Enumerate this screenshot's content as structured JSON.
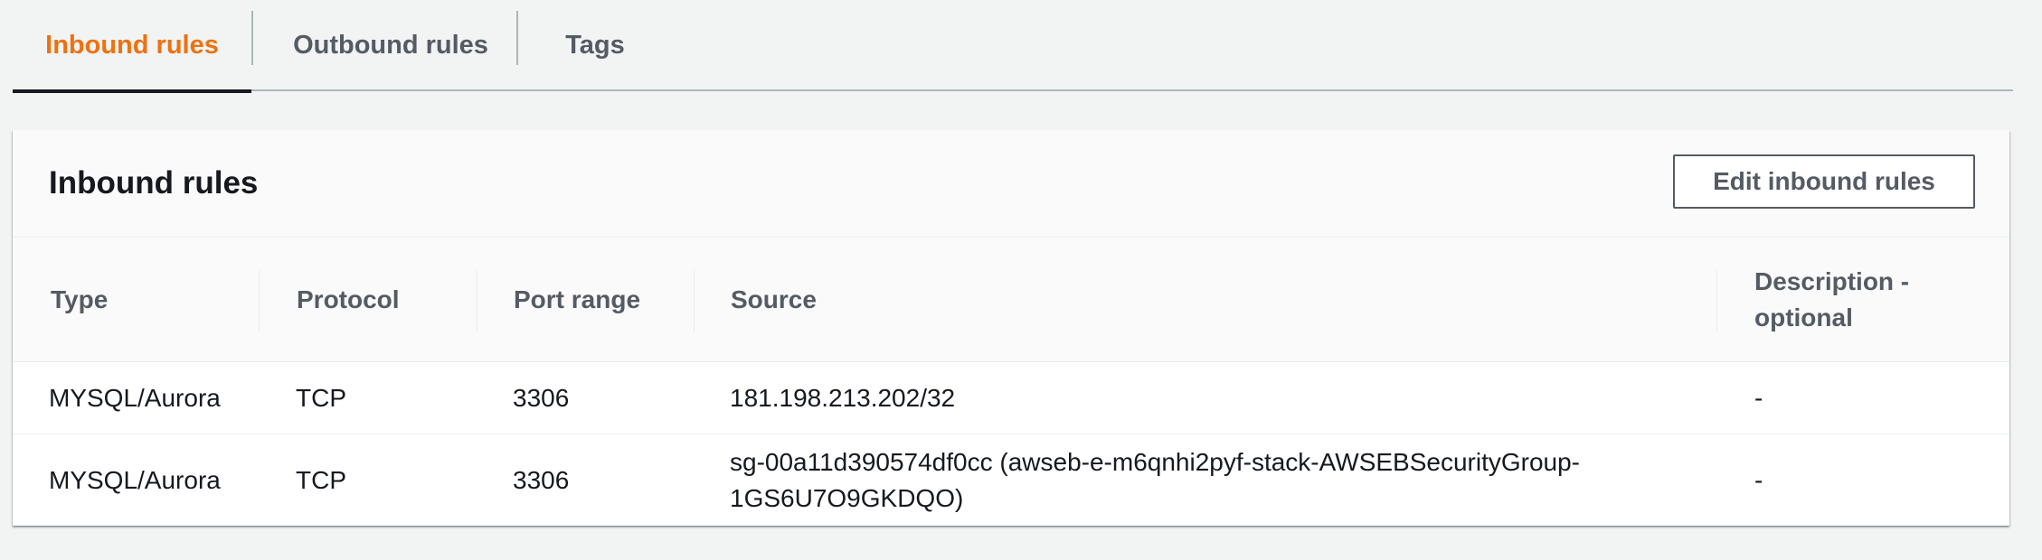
{
  "tabs": [
    {
      "label": "Inbound rules",
      "active": true
    },
    {
      "label": "Outbound rules",
      "active": false
    },
    {
      "label": "Tags",
      "active": false
    }
  ],
  "panel": {
    "title": "Inbound rules",
    "edit_button_label": "Edit inbound rules"
  },
  "table": {
    "columns": {
      "type": "Type",
      "protocol": "Protocol",
      "port_range": "Port range",
      "source": "Source",
      "description": "Description - optional"
    },
    "rows": [
      {
        "type": "MYSQL/Aurora",
        "protocol": "TCP",
        "port_range": "3306",
        "source": "181.198.213.202/32",
        "description": "-"
      },
      {
        "type": "MYSQL/Aurora",
        "protocol": "TCP",
        "port_range": "3306",
        "source": "sg-00a11d390574df0cc (awseb-e-m6qnhi2pyf-stack-AWSEBSecurityGroup-1GS6U7O9GKDQO)",
        "description": "-"
      }
    ]
  },
  "colors": {
    "accent": "#ec7211",
    "page_background": "#f2f3f3",
    "text_primary": "#16191f",
    "text_secondary": "#545b64"
  }
}
